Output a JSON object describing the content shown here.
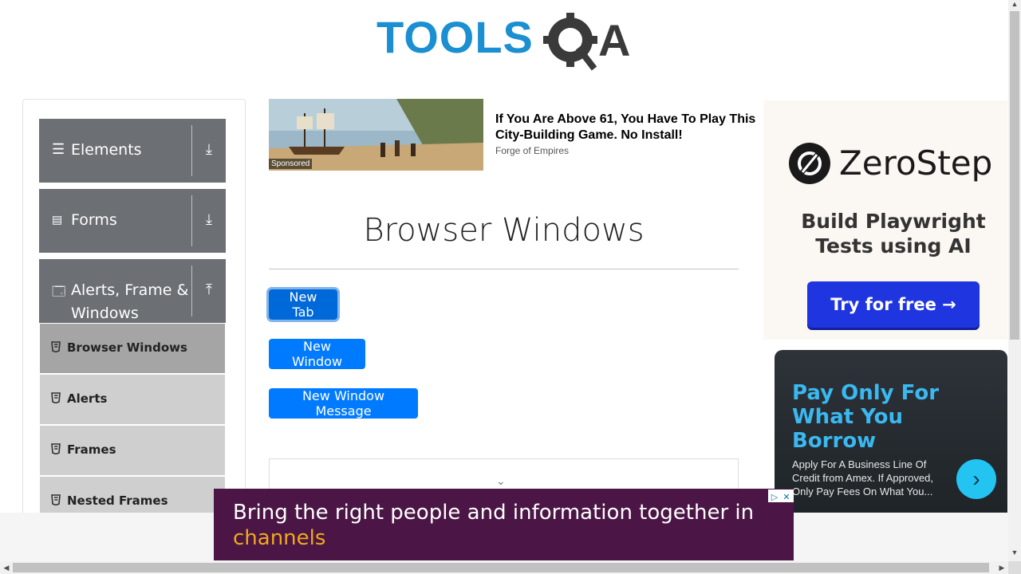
{
  "header": {
    "logo_text_left": "TOOLS",
    "logo_text_right": "A"
  },
  "sidebar": {
    "groups": [
      {
        "label": "Elements",
        "icon": "hamburger-icon",
        "arrow": "download-icon"
      },
      {
        "label": "Forms",
        "icon": "document-icon",
        "arrow": "download-icon"
      },
      {
        "label": "Alerts, Frame & Windows",
        "icon": "window-icon",
        "arrow": "upload-icon"
      }
    ],
    "items": [
      {
        "label": "Browser Windows",
        "active": true
      },
      {
        "label": "Alerts",
        "active": false
      },
      {
        "label": "Frames",
        "active": false
      },
      {
        "label": "Nested Frames",
        "active": false
      }
    ]
  },
  "ad": {
    "headline": "If You Are Above 61, You Have To Play This City-Building Game. No Install!",
    "source": "Forge of Empires",
    "sponsored": "Sponsored"
  },
  "main": {
    "title": "Browser Windows",
    "buttons": {
      "new_tab": "New Tab",
      "new_window": "New Window",
      "new_window_message": "New Window Message"
    }
  },
  "right_ads": {
    "zerostep": {
      "name": "ZeroStep",
      "tagline": "Build Playwright Tests using AI",
      "cta": "Try for free →"
    },
    "amex": {
      "title": "Pay Only For What You Borrow",
      "body": "Apply For A Business Line Of Credit from Amex. If Approved, Only Pay Fees On What You..."
    }
  },
  "banner": {
    "text_part1": "Bring the right people and information together in ",
    "text_highlight": "channels"
  },
  "colors": {
    "primary": "#007bff",
    "sidebar_group": "#6c7075",
    "sidebar_item": "#cfcfcf",
    "sidebar_item_active": "#a5a5a5",
    "banner_bg": "#4b1646",
    "banner_highlight": "#f0a91b",
    "logo_blue": "#1b8fd2"
  }
}
